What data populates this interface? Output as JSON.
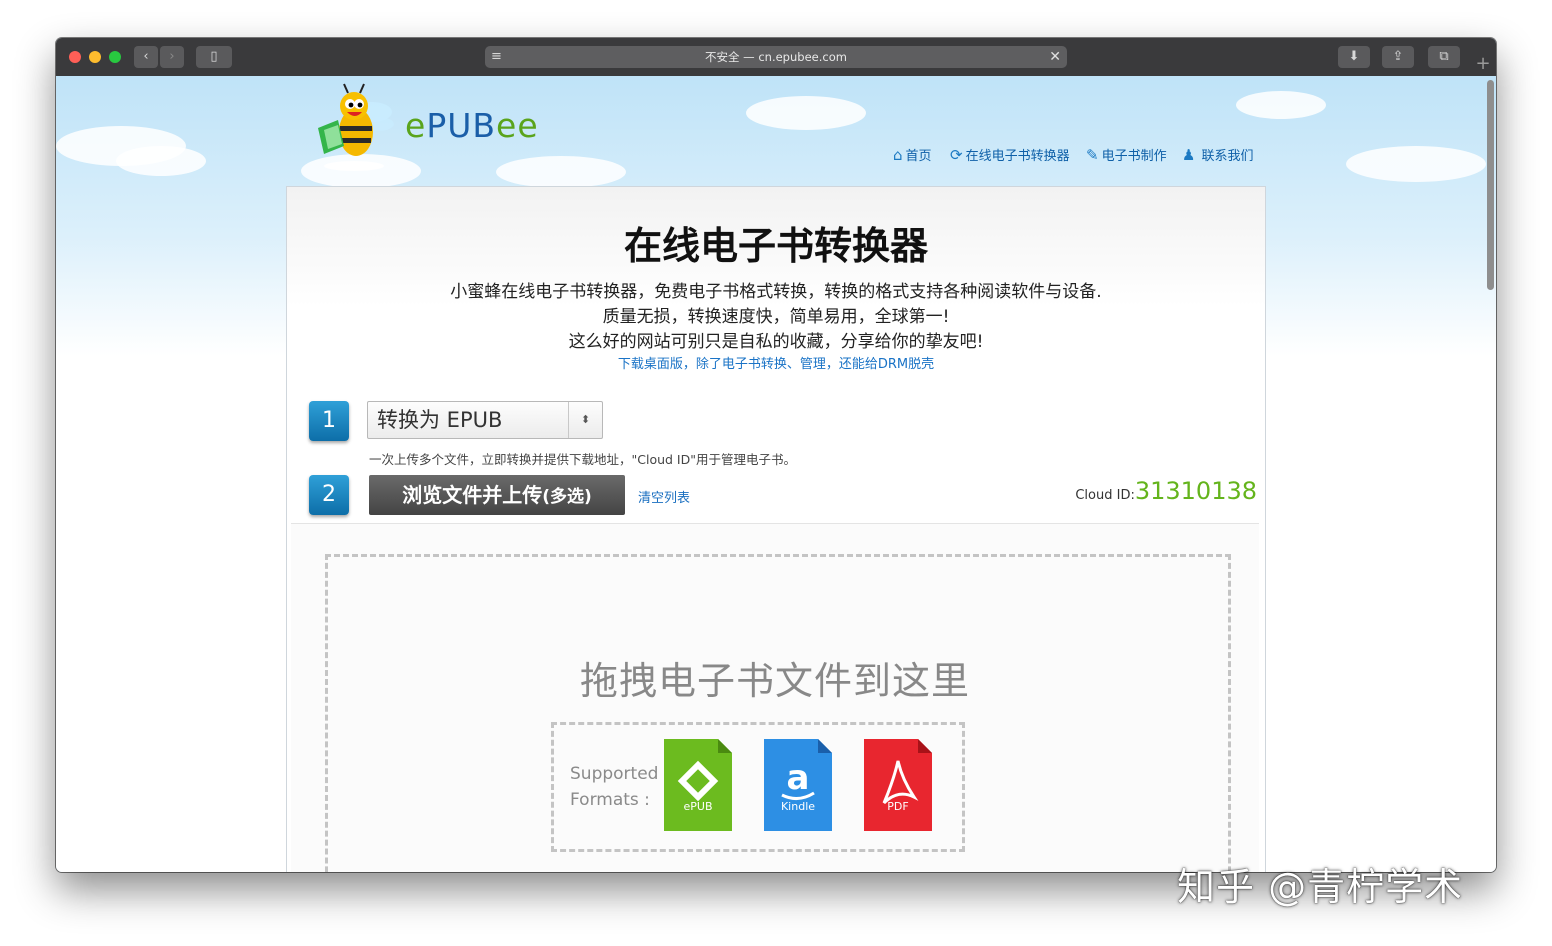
{
  "browser": {
    "address": "不安全 — cn.epubee.com",
    "icons": [
      "back-icon",
      "forward-icon",
      "sidebar-icon",
      "reader-icon",
      "close-icon",
      "download-icon",
      "share-icon",
      "tabs-icon",
      "new-tab-icon"
    ]
  },
  "header": {
    "logo_text_e": "e",
    "logo_text_pub": "PUB",
    "logo_text_ee": "ee",
    "nav": [
      {
        "label": "首页",
        "icon": "home-icon"
      },
      {
        "label": "在线电子书转换器",
        "icon": "refresh-icon"
      },
      {
        "label": "电子书制作",
        "icon": "edit-icon"
      },
      {
        "label": "联系我们",
        "icon": "user-icon"
      }
    ]
  },
  "main": {
    "title": "在线电子书转换器",
    "desc_line1": "小蜜蜂在线电子书转换器，免费电子书格式转换，转换的格式支持各种阅读软件与设备.",
    "desc_line2": "质量无损，转换速度快，简单易用，全球第一!",
    "desc_line3": "这么好的网站可别只是自私的收藏，分享给你的挚友吧!",
    "download_link": "下载桌面版，除了电子书转换、管理，还能给DRM脱壳",
    "step1": "1",
    "step2": "2",
    "format_select": "转换为 EPUB",
    "hint": "一次上传多个文件，立即转换并提供下载地址，\"Cloud ID\"用于管理电子书。",
    "upload_label": "浏览文件并上传",
    "upload_suffix": "(多选)",
    "clear_label": "清空列表",
    "cloud_id_label": "Cloud ID:",
    "cloud_id_value": "31310138",
    "drop_text": "拖拽电子书文件到这里",
    "supported_line1": "Supported",
    "supported_line2": "Formats :",
    "formats": [
      {
        "name": "ePUB",
        "color": "#6cbb1f"
      },
      {
        "name": "Kindle",
        "color": "#2d8fe4"
      },
      {
        "name": "PDF",
        "color": "#e8262f"
      }
    ]
  },
  "watermark": "知乎 @青柠学术",
  "colors": {
    "accent": "#64b41c",
    "link": "#1a73c6",
    "step": "#1b86c4"
  }
}
